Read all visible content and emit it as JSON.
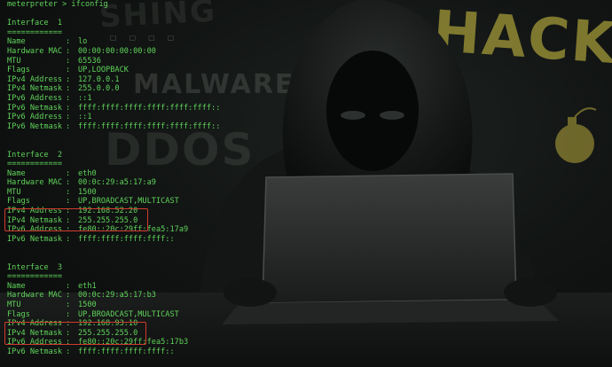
{
  "terminal": {
    "prompt": "meterpreter > ifconfig",
    "interfaces": [
      {
        "header": "Interface  1",
        "rule": "============",
        "rows": [
          {
            "key": "Name",
            "value": "lo"
          },
          {
            "key": "Hardware MAC",
            "value": "00:00:00:00:00:00"
          },
          {
            "key": "MTU",
            "value": "65536"
          },
          {
            "key": "Flags",
            "value": "UP,LOOPBACK"
          },
          {
            "key": "IPv4 Address",
            "value": "127.0.0.1"
          },
          {
            "key": "IPv4 Netmask",
            "value": "255.0.0.0"
          },
          {
            "key": "IPv6 Address",
            "value": "::1"
          },
          {
            "key": "IPv6 Netmask",
            "value": "ffff:ffff:ffff:ffff:ffff:ffff::"
          },
          {
            "key": "IPv6 Address",
            "value": "::1"
          },
          {
            "key": "IPv6 Netmask",
            "value": "ffff:ffff:ffff:ffff:ffff:ffff::"
          }
        ]
      },
      {
        "header": "Interface  2",
        "rule": "============",
        "rows": [
          {
            "key": "Name",
            "value": "eth0"
          },
          {
            "key": "Hardware MAC",
            "value": "00:0c:29:a5:17:a9"
          },
          {
            "key": "MTU",
            "value": "1500"
          },
          {
            "key": "Flags",
            "value": "UP,BROADCAST,MULTICAST"
          },
          {
            "key": "IPv4 Address",
            "value": "192.168.52.20"
          },
          {
            "key": "IPv4 Netmask",
            "value": "255.255.255.0"
          },
          {
            "key": "IPv6 Address",
            "value": "fe80::20c:29ff:fea5:17a9"
          },
          {
            "key": "IPv6 Netmask",
            "value": "ffff:ffff:ffff:ffff::"
          }
        ]
      },
      {
        "header": "Interface  3",
        "rule": "============",
        "rows": [
          {
            "key": "Name",
            "value": "eth1"
          },
          {
            "key": "Hardware MAC",
            "value": "00:0c:29:a5:17:b3"
          },
          {
            "key": "MTU",
            "value": "1500"
          },
          {
            "key": "Flags",
            "value": "UP,BROADCAST,MULTICAST"
          },
          {
            "key": "IPv4 Address",
            "value": "192.168.93.10"
          },
          {
            "key": "IPv4 Netmask",
            "value": "255.255.255.0"
          },
          {
            "key": "IPv6 Address",
            "value": "fe80::20c:29ff:fea5:17b3"
          },
          {
            "key": "IPv6 Netmask",
            "value": "ffff:ffff:ffff:ffff::"
          }
        ]
      }
    ],
    "separator": ":"
  },
  "background": {
    "words": [
      "SHING",
      "MALWARE",
      "DDOS",
      "HACK"
    ]
  },
  "colors": {
    "terminal_text": "#5fd35a",
    "highlight_box": "#d23a2c",
    "hack_text": "#d7c846"
  }
}
